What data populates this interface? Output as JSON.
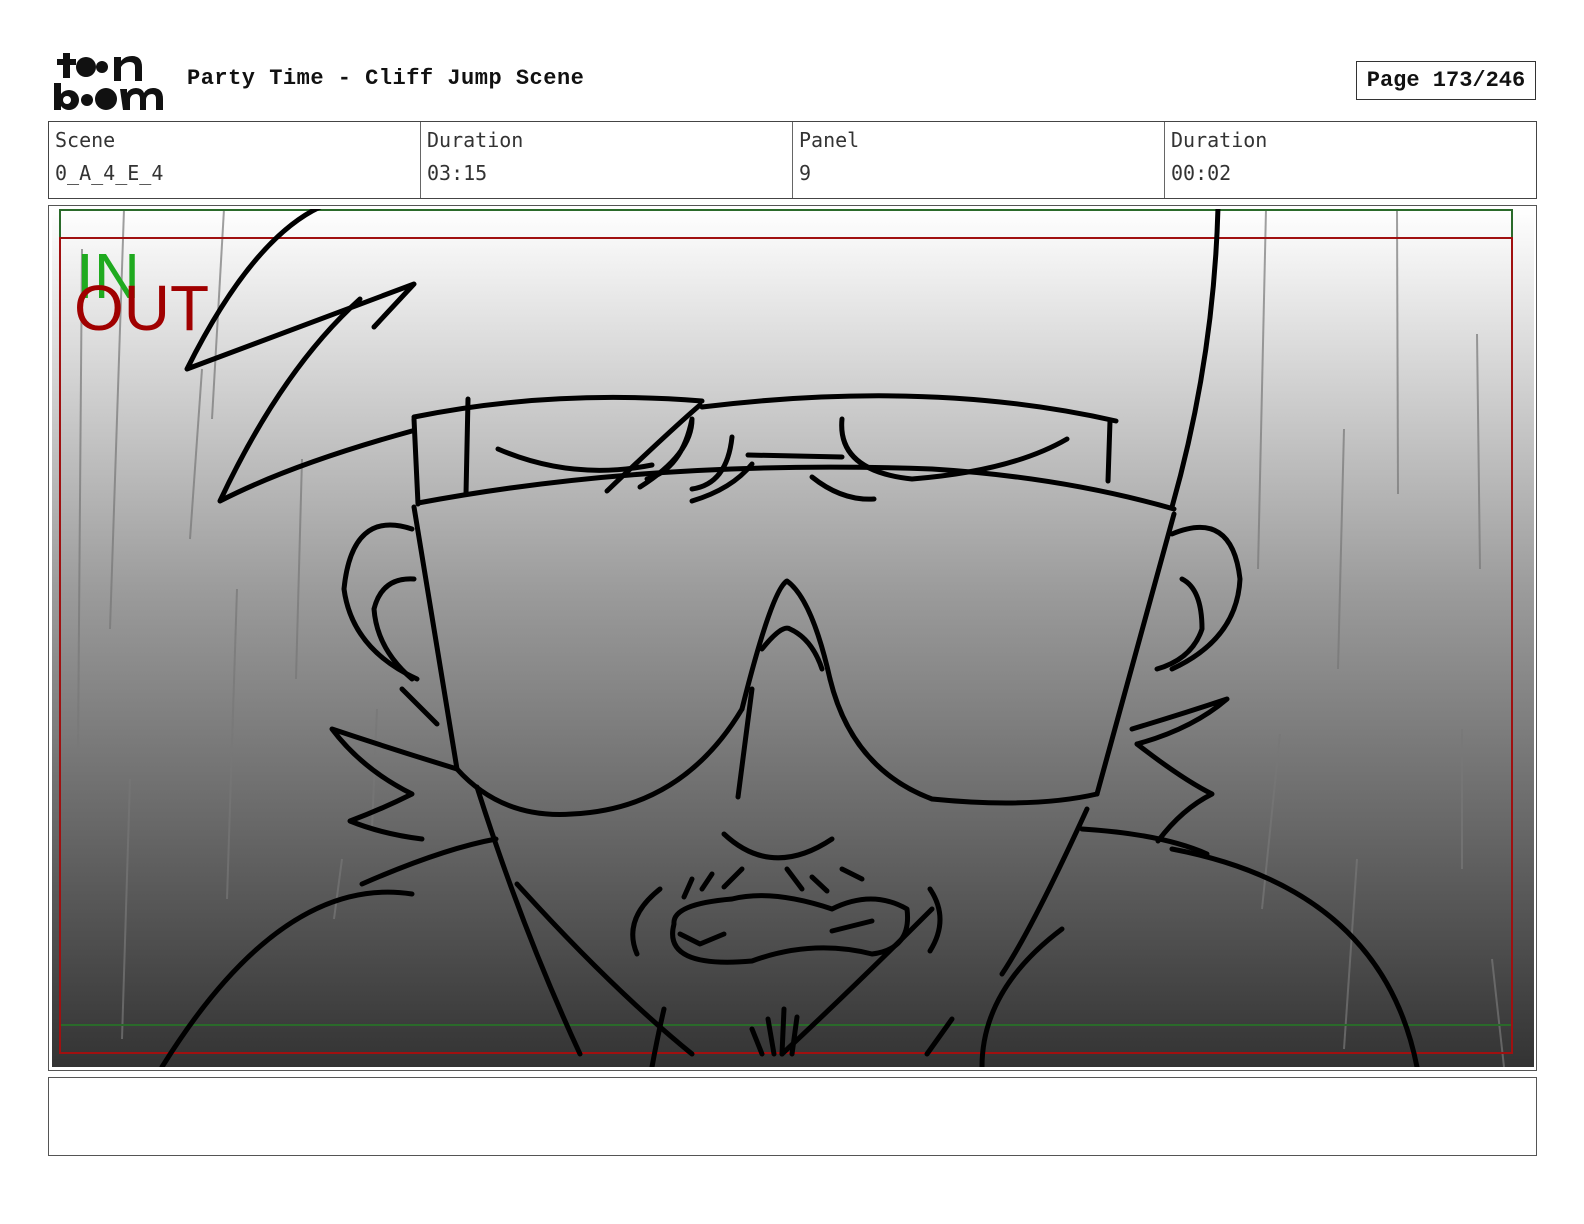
{
  "header": {
    "logo_text": "toon boom",
    "project_title": "Party Time - Cliff Jump Scene",
    "page_indicator": "Page 173/246"
  },
  "info": {
    "scene_label": "Scene",
    "scene_value": "0_A_4_E_4",
    "scene_duration_label": "Duration",
    "scene_duration_value": "03:15",
    "panel_label": "Panel",
    "panel_value": "9",
    "panel_duration_label": "Duration",
    "panel_duration_value": "00:02"
  },
  "panel": {
    "in_marker": "IN",
    "out_marker": "OUT",
    "in_color": "#1faa1f",
    "out_color": "#a00000",
    "drawing_subject": "close-up-face-sunglasses-headband"
  },
  "notes": {
    "text": ""
  }
}
